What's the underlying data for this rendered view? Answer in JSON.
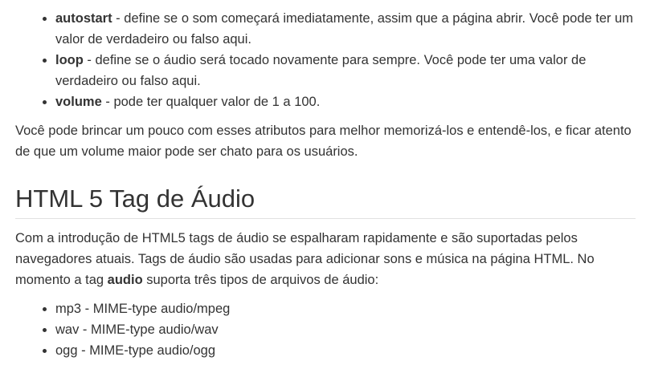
{
  "attributes": [
    {
      "name": "autostart",
      "separator": " - ",
      "description": "define se o som começará imediatamente, assim que a página abrir. Você pode ter um valor de verdadeiro ou falso aqui."
    },
    {
      "name": "loop",
      "separator": " - ",
      "description": "define se o áudio será tocado novamente para sempre. Você pode ter uma valor de verdadeiro ou falso aqui."
    },
    {
      "name": "volume",
      "separator": " - ",
      "description": "pode ter qualquer valor de 1 a 100."
    }
  ],
  "intro_paragraph": "Você pode brincar um pouco com esses atributos para melhor memorizá-los e entendê-los, e ficar atento de que um volume maior pode ser chato para os usuários.",
  "section": {
    "heading": "HTML 5 Tag de Áudio",
    "paragraph_before": "Com a introdução de HTML5 tags de áudio se espalharam rapidamente e são suportadas pelos navegadores atuais. Tags de áudio são usadas para adicionar sons e música na página HTML. No momento a tag ",
    "paragraph_bold": "audio",
    "paragraph_after": " suporta três tipos de arquivos de áudio:",
    "formats": [
      "mp3 - MIME-type audio/mpeg",
      "wav - MIME-type audio/wav",
      "ogg - MIME-type audio/ogg"
    ]
  }
}
